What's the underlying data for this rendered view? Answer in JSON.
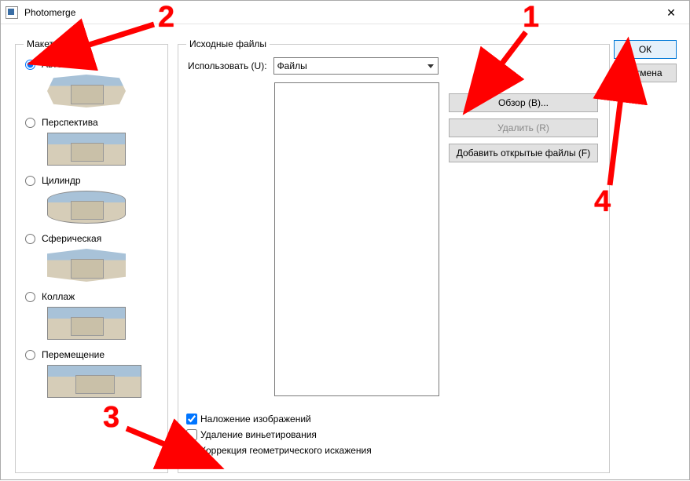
{
  "window": {
    "title": "Photomerge"
  },
  "layout": {
    "legend": "Макет",
    "options": {
      "auto": "Авто",
      "perspective": "Перспектива",
      "cylinder": "Цилиндр",
      "spherical": "Сферическая",
      "collage": "Коллаж",
      "reposition": "Перемещение"
    },
    "selected": "auto"
  },
  "source": {
    "legend": "Исходные файлы",
    "use_label": "Использовать (U):",
    "use_value": "Файлы",
    "buttons": {
      "browse": "Обзор (B)...",
      "remove": "Удалить (R)",
      "add_open": "Добавить открытые файлы (F)"
    },
    "checks": {
      "blend": "Наложение изображений",
      "vignette": "Удаление виньетирования",
      "geometric": "Коррекция геометрического искажения"
    },
    "blend_checked": true
  },
  "dialog": {
    "ok": "ОК",
    "cancel": "Отмена"
  },
  "annotations": {
    "n1": "1",
    "n2": "2",
    "n3": "3",
    "n4": "4"
  }
}
